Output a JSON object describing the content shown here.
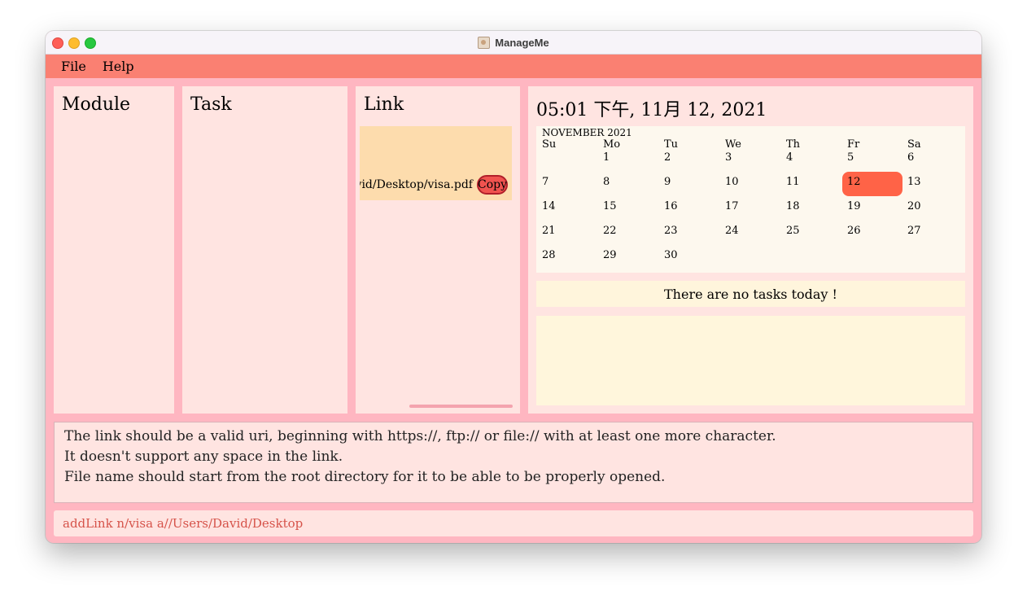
{
  "window": {
    "title": "ManageMe"
  },
  "menu": {
    "items": [
      "File",
      "Help"
    ]
  },
  "panels": {
    "module": {
      "title": "Module"
    },
    "task": {
      "title": "Task"
    },
    "link": {
      "title": "Link",
      "items": [
        {
          "path": "/Users/David/Desktop/visa.pdf",
          "copy_label": "Copy"
        }
      ]
    }
  },
  "calendar": {
    "datetime": "05:01 下午, 11月 12, 2021",
    "month_label": "NOVEMBER 2021",
    "weekdays": [
      "Su",
      "Mo",
      "Tu",
      "We",
      "Th",
      "Fr",
      "Sa"
    ],
    "weeks": [
      [
        "",
        "1",
        "2",
        "3",
        "4",
        "5",
        "6"
      ],
      [
        "7",
        "8",
        "9",
        "10",
        "11",
        "12",
        "13"
      ],
      [
        "14",
        "15",
        "16",
        "17",
        "18",
        "19",
        "20"
      ],
      [
        "21",
        "22",
        "23",
        "24",
        "25",
        "26",
        "27"
      ],
      [
        "28",
        "29",
        "30",
        "",
        "",
        "",
        ""
      ]
    ],
    "today": "12",
    "no_tasks_message": "There are no tasks today !"
  },
  "result": {
    "lines": [
      "The link should be a valid uri, beginning with https://, ftp:// or file:// with at least one more character.",
      "It doesn't support any space in the link.",
      "File name should start from the root directory for it to be able to be properly opened."
    ]
  },
  "command": {
    "value": "addLink n/visa a//Users/David/Desktop"
  },
  "colors": {
    "menubar": "#fa8072",
    "panel": "#ffe4e1",
    "background": "#ffb6c1",
    "today_highlight": "#ff6347",
    "link_card": "#fddcad",
    "copy_button": "#f0534f"
  }
}
